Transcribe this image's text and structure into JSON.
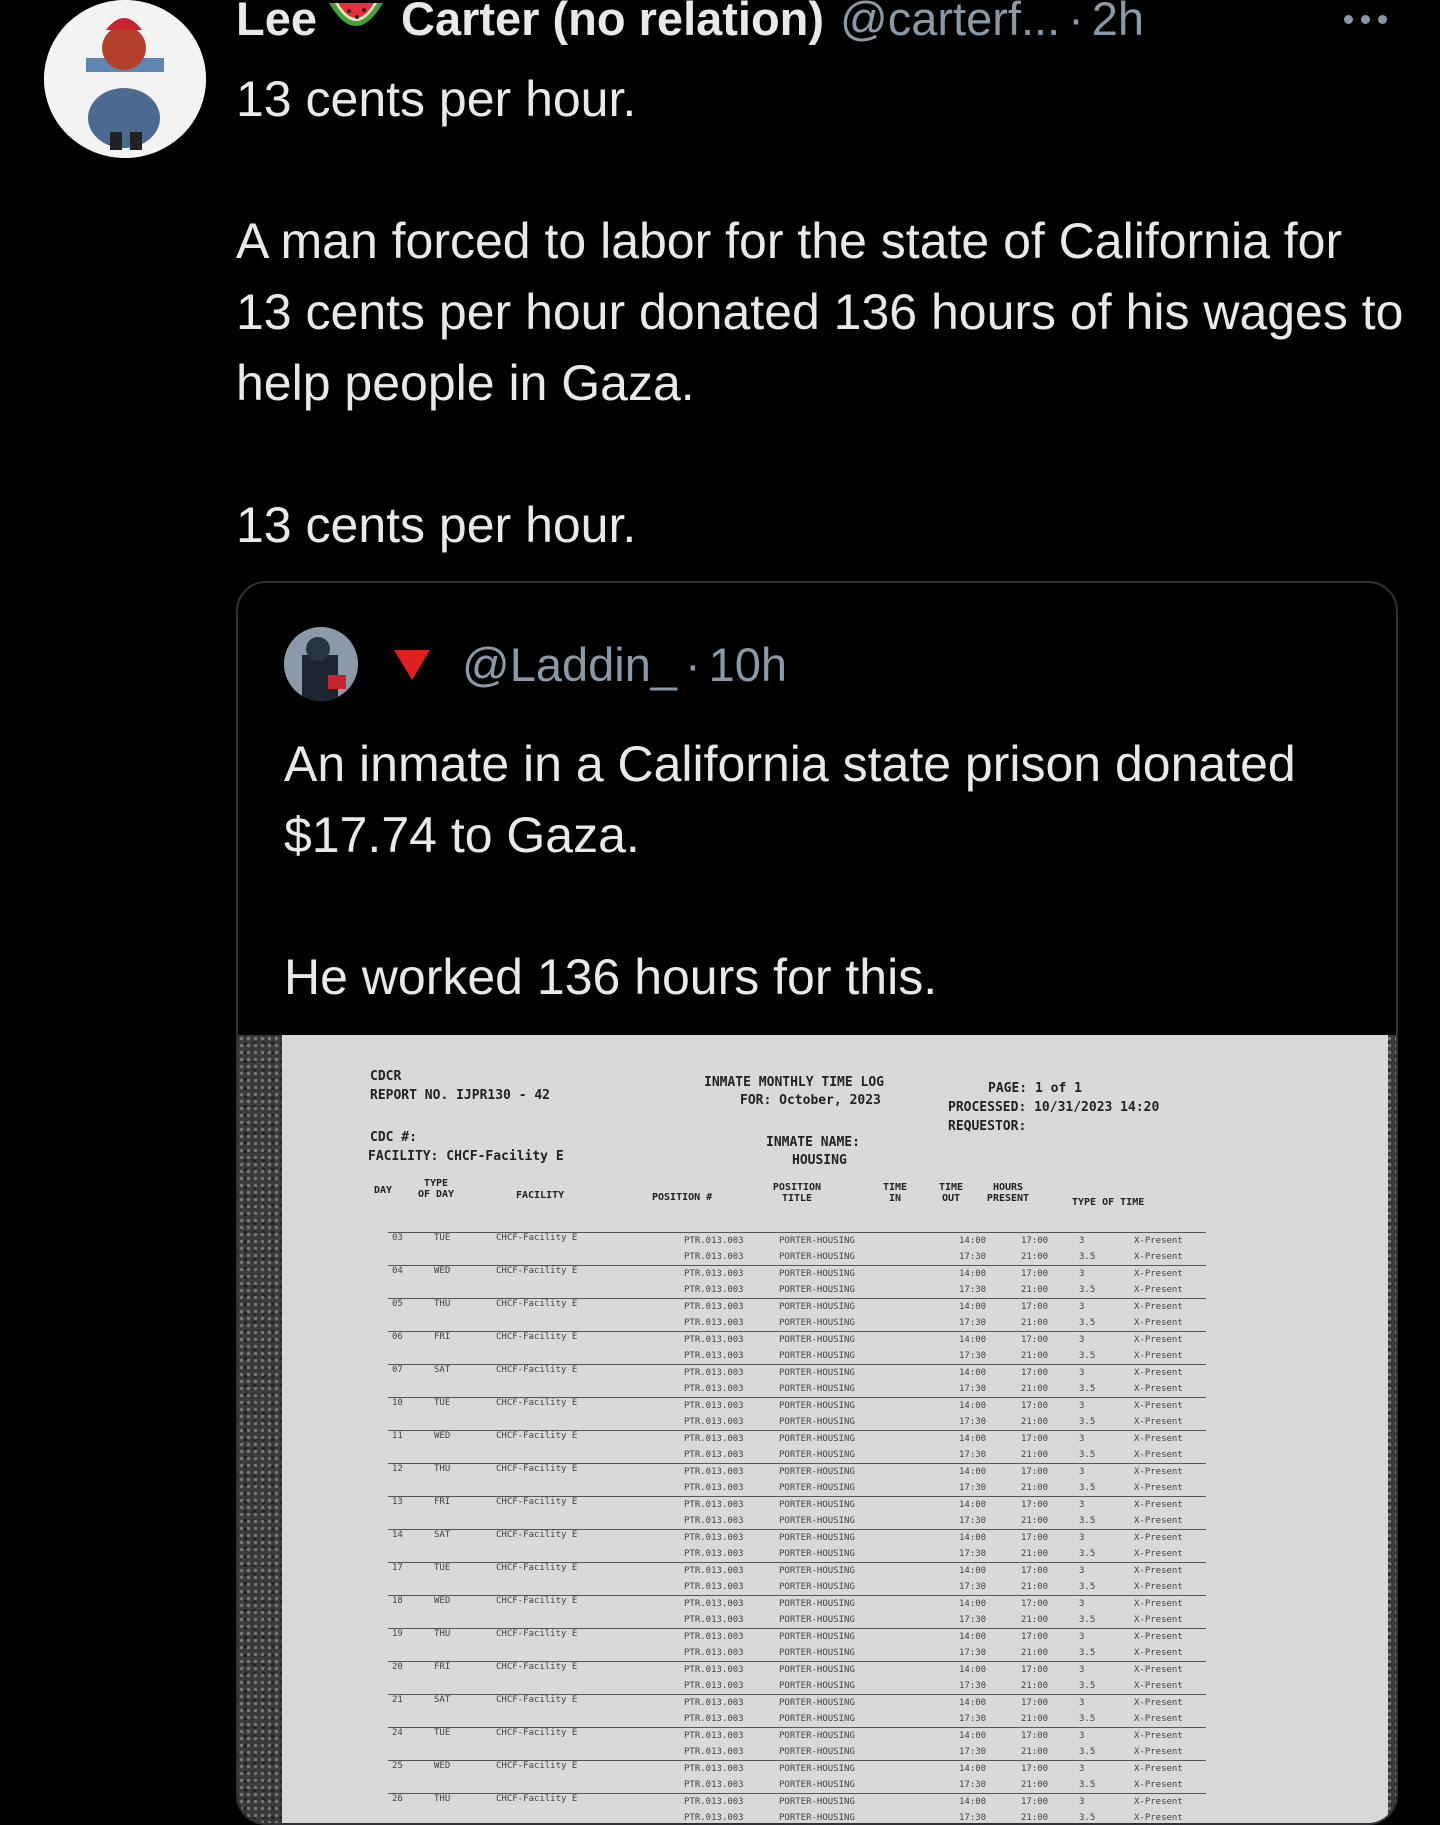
{
  "tweet": {
    "author_name_first": "Lee",
    "author_name_rest": "Carter (no relation)",
    "handle": "@carterf...",
    "time": "2h",
    "text": "13 cents per hour.\n\nA man forced to labor for the state of California for 13 cents per hour donated 136 hours of his wages to help people in Gaza.\n\n13 cents per hour."
  },
  "quote": {
    "handle": "@Laddin_",
    "time": "10h",
    "text": "An inmate in a California state prison donated $17.74 to Gaza.\n\nHe worked 136 hours for this."
  },
  "document": {
    "org": "CDCR",
    "report_no": "REPORT NO. IJPR130 - 42",
    "title": "INMATE MONTHLY TIME LOG",
    "for_line": "FOR: October, 2023",
    "page": "PAGE: 1 of 1",
    "processed": "PROCESSED: 10/31/2023 14:20",
    "requestor": "REQUESTOR:",
    "cdc": "CDC #:",
    "facility": "FACILITY: CHCF-Facility E",
    "inmate_name": "INMATE NAME:",
    "housing": "HOUSING",
    "headers": [
      "DAY",
      "TYPE OF DAY",
      "FACILITY",
      "POSITION #",
      "POSITION TITLE",
      "TIME IN",
      "TIME OUT",
      "HOURS PRESENT",
      "TYPE OF TIME"
    ],
    "rows": [
      {
        "day": "03",
        "dow": "TUE"
      },
      {
        "day": "04",
        "dow": "WED"
      },
      {
        "day": "05",
        "dow": "THU"
      },
      {
        "day": "06",
        "dow": "FRI"
      },
      {
        "day": "07",
        "dow": "SAT"
      },
      {
        "day": "10",
        "dow": "TUE"
      },
      {
        "day": "11",
        "dow": "WED"
      },
      {
        "day": "12",
        "dow": "THU"
      },
      {
        "day": "13",
        "dow": "FRI"
      },
      {
        "day": "14",
        "dow": "SAT"
      },
      {
        "day": "17",
        "dow": "TUE"
      },
      {
        "day": "18",
        "dow": "WED"
      },
      {
        "day": "19",
        "dow": "THU"
      },
      {
        "day": "20",
        "dow": "FRI"
      },
      {
        "day": "21",
        "dow": "SAT"
      },
      {
        "day": "24",
        "dow": "TUE"
      },
      {
        "day": "25",
        "dow": "WED"
      },
      {
        "day": "26",
        "dow": "THU"
      }
    ],
    "row_facility": "CHCF-Facility E",
    "row_position": "PTR.013.003",
    "row_title": "PORTER-HOUSING",
    "row_time_in": [
      "14:00",
      "17:30"
    ],
    "row_time_out": [
      "17:00",
      "21:00"
    ],
    "row_hours": [
      "3",
      "3.5"
    ],
    "row_type": "X-Present"
  },
  "icons": {
    "more": "more-horizontal-icon",
    "emoji": "watermelon-emoji",
    "flag": "red-triangle-emoji"
  }
}
